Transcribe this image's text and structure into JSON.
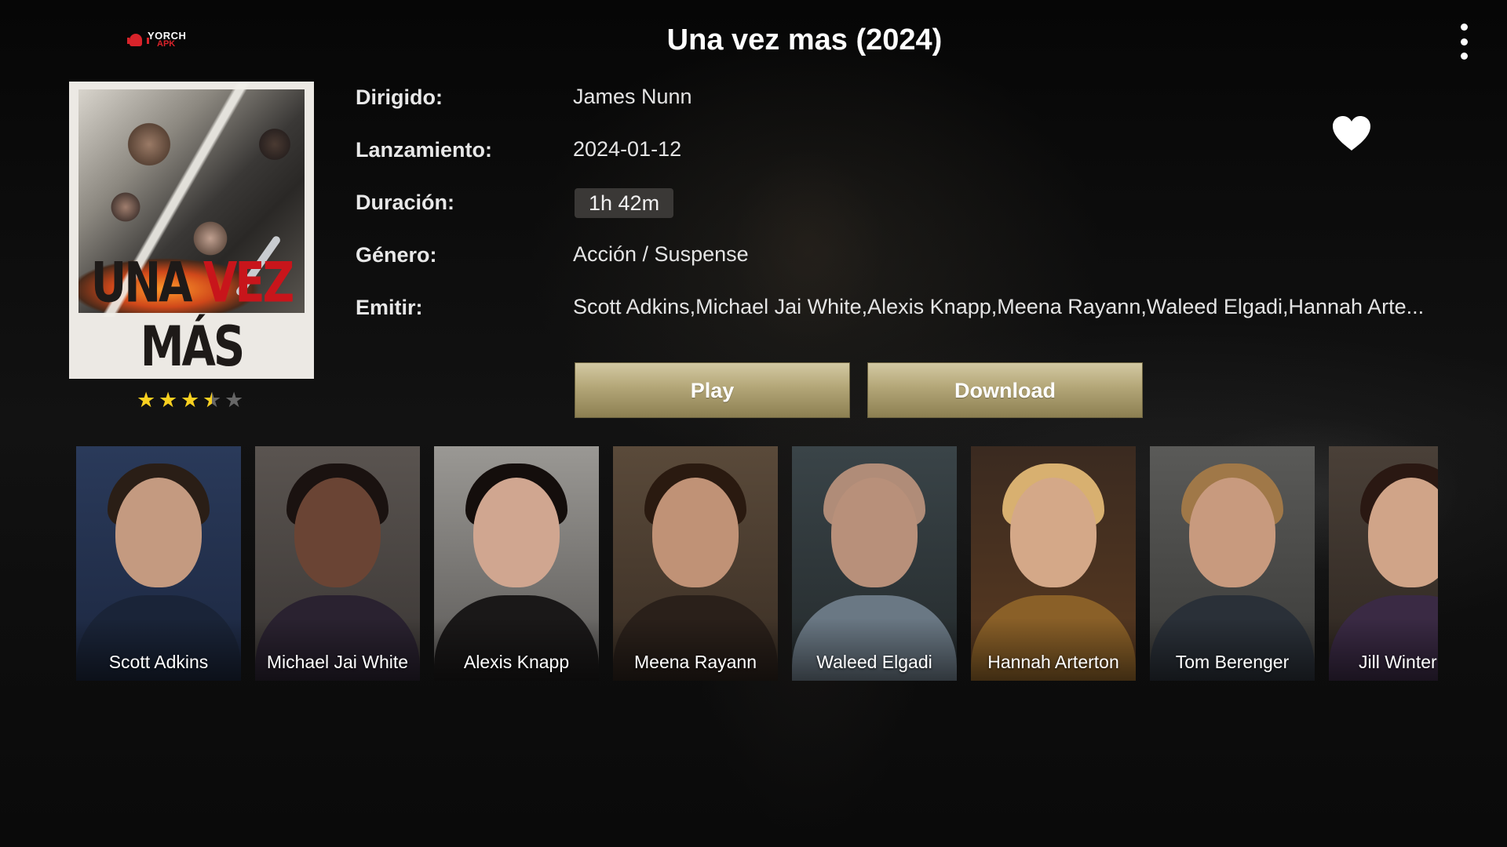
{
  "header": {
    "logo_line1": "YORCH",
    "logo_line2": "APK",
    "title": "Una vez mas (2024)"
  },
  "poster": {
    "title_part1": "UNA ",
    "title_part2": "VEZ",
    "title_part3": " MÁS",
    "rating_stars": 3.5,
    "rating_max": 5
  },
  "details": {
    "director_label": "Dirigido:",
    "director_value": "James Nunn",
    "release_label": "Lanzamiento:",
    "release_value": "2024-01-12",
    "duration_label": "Duración:",
    "duration_value": "1h 42m",
    "genre_label": "Género:",
    "genre_value": "Acción / Suspense",
    "cast_label": "Emitir:",
    "cast_value": "Scott Adkins,Michael Jai White,Alexis Knapp,Meena Rayann,Waleed Elgadi,Hannah Arte..."
  },
  "actions": {
    "play_label": "Play",
    "download_label": "Download",
    "favorite_icon": "heart-icon",
    "menu_icon": "more-vertical-icon"
  },
  "cast": [
    {
      "name": "Scott Adkins"
    },
    {
      "name": "Michael Jai White"
    },
    {
      "name": "Alexis Knapp"
    },
    {
      "name": "Meena Rayann"
    },
    {
      "name": "Waleed Elgadi"
    },
    {
      "name": "Hannah Arterton"
    },
    {
      "name": "Tom Berenger"
    },
    {
      "name": "Jill Winter"
    }
  ],
  "colors": {
    "accent_gold": "#b3a677",
    "star_yellow": "#f8d020",
    "logo_red": "#d8232a"
  }
}
